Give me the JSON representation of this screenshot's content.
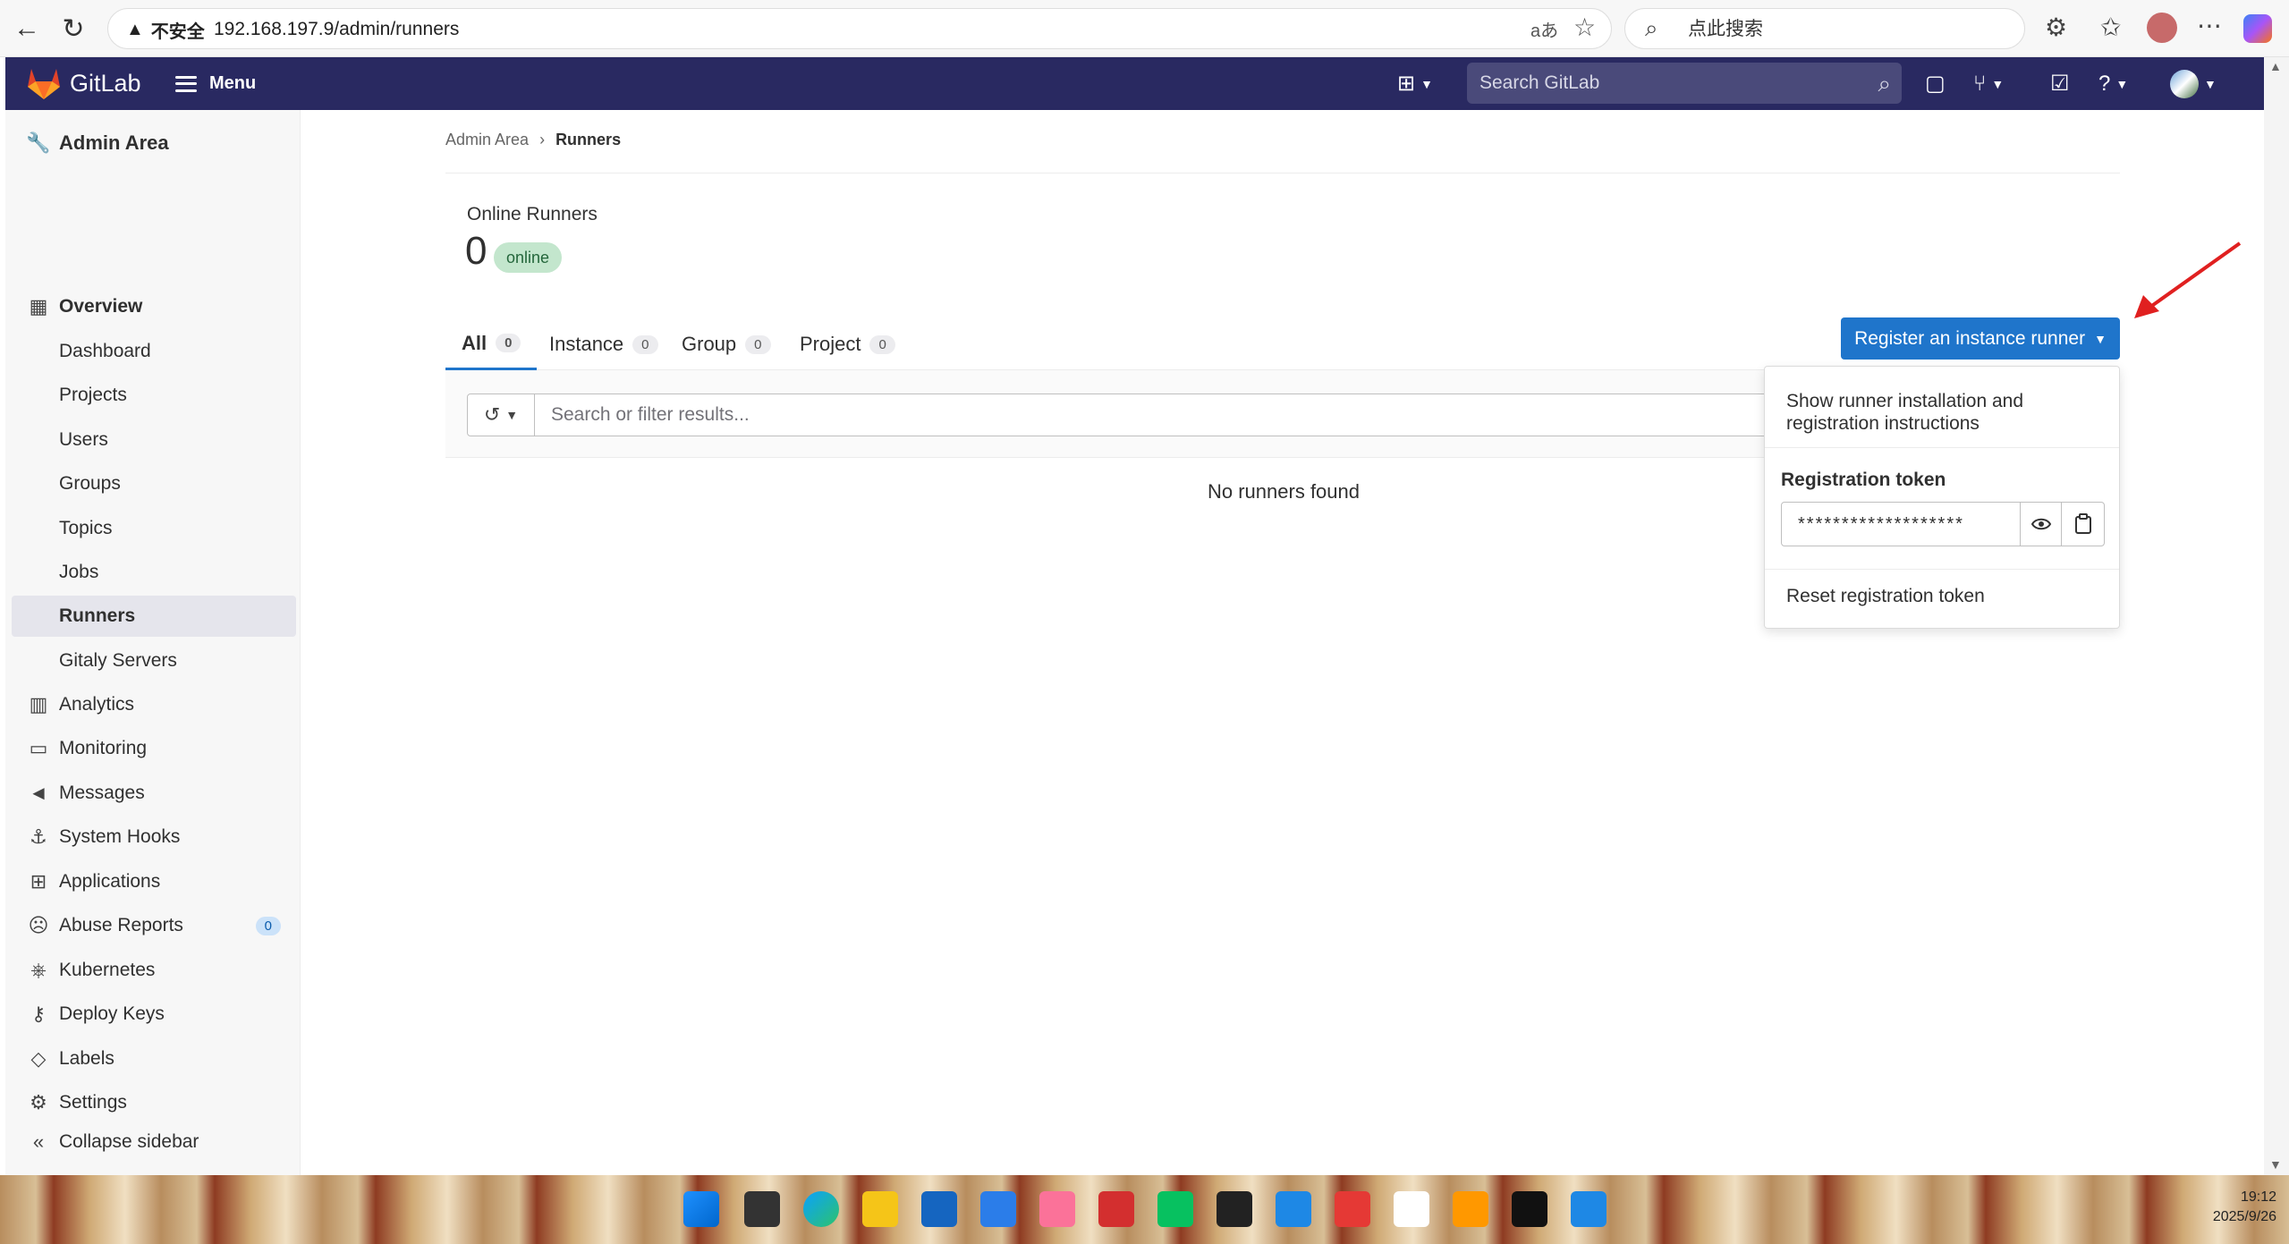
{
  "browser": {
    "security": "不安全",
    "url": "192.168.197.9/admin/runners",
    "search_placeholder": "点此搜索"
  },
  "header": {
    "brand": "GitLab",
    "menu_label": "Menu",
    "search_placeholder": "Search GitLab"
  },
  "sidebar": {
    "title": "Admin Area",
    "overview": "Overview",
    "sub_items": [
      "Dashboard",
      "Projects",
      "Users",
      "Groups",
      "Topics",
      "Jobs",
      "Runners",
      "Gitaly Servers"
    ],
    "items": [
      "Analytics",
      "Monitoring",
      "Messages",
      "System Hooks",
      "Applications",
      "Abuse Reports",
      "Kubernetes",
      "Deploy Keys",
      "Labels",
      "Settings"
    ],
    "abuse_badge": "0",
    "collapse_label": "Collapse sidebar"
  },
  "breadcrumb": {
    "root": "Admin Area",
    "current": "Runners"
  },
  "stats": {
    "online_label": "Online Runners",
    "online_count": "0",
    "online_pill": "online"
  },
  "tabs": [
    {
      "label": "All",
      "count": "0"
    },
    {
      "label": "Instance",
      "count": "0"
    },
    {
      "label": "Group",
      "count": "0"
    },
    {
      "label": "Project",
      "count": "0"
    }
  ],
  "register_button": "Register an instance runner",
  "filter": {
    "placeholder": "Search or filter results..."
  },
  "empty_state": "No runners found",
  "dropdown": {
    "instructions": "Show runner installation and registration instructions",
    "token_title": "Registration token",
    "token_masked": "*******************",
    "reset": "Reset registration token"
  },
  "taskbar": {
    "time": "19:12",
    "date": "2025/9/26"
  },
  "colors": {
    "header_bg": "#292961",
    "primary": "#1f75cb",
    "annotation_arrow": "#e02020"
  }
}
